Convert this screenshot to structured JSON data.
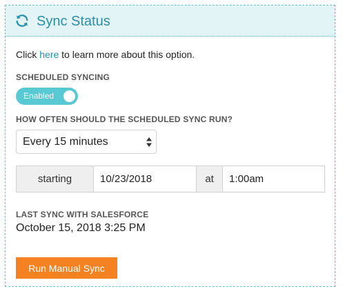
{
  "panel": {
    "title": "Sync Status",
    "icon": "sync-icon",
    "accent_color": "#2a8fa8"
  },
  "learn_more": {
    "prefix": "Click ",
    "link_text": "here",
    "suffix": " to learn more about this option."
  },
  "scheduled_syncing": {
    "label": "SCHEDULED SYNCING",
    "toggle_label": "Enabled",
    "toggle_on": true,
    "toggle_color": "#58c8d3"
  },
  "frequency": {
    "label": "HOW OFTEN SHOULD THE SCHEDULED SYNC RUN?",
    "selected": "Every 15 minutes"
  },
  "starting": {
    "starting_label": "starting",
    "date_value": "10/23/2018",
    "at_label": "at",
    "time_value": "1:00am"
  },
  "last_sync": {
    "label": "LAST SYNC WITH SALESFORCE",
    "value": "October 15, 2018 3:25 PM"
  },
  "actions": {
    "run_manual_sync": "Run Manual Sync",
    "button_color": "#f58220"
  }
}
